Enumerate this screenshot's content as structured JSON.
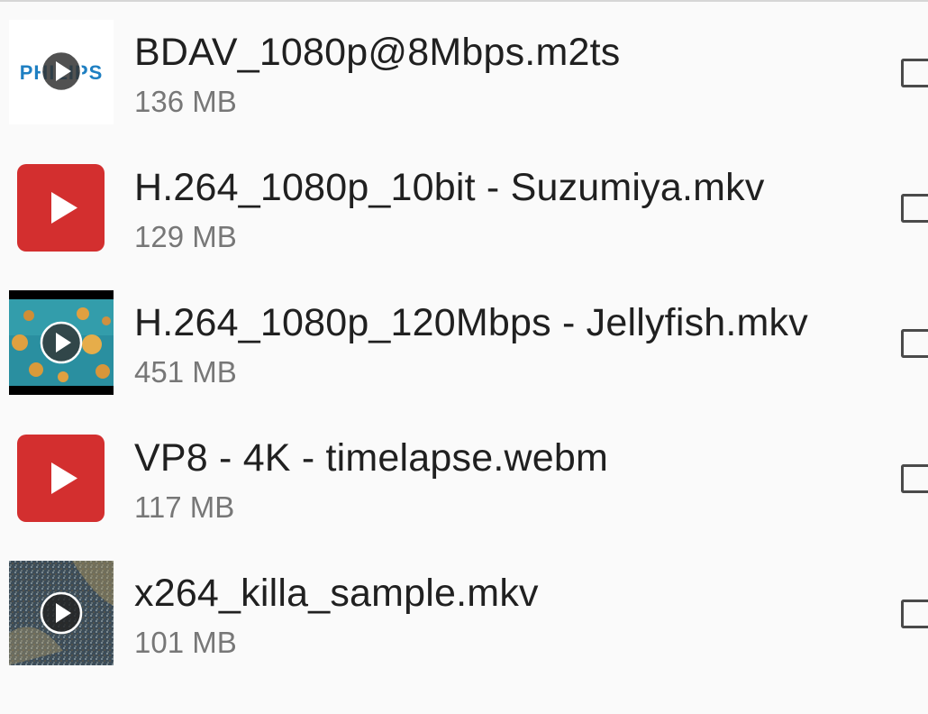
{
  "files": [
    {
      "name": "BDAV_1080p@8Mbps.m2ts",
      "size": "136 MB",
      "thumbnail": "philips-logo-thumbnail",
      "thumb_text": "PHILIPS",
      "checked": false
    },
    {
      "name": "H.264_1080p_10bit - Suzumiya.mkv",
      "size": "129 MB",
      "thumbnail": "play-icon",
      "checked": false
    },
    {
      "name": "H.264_1080p_120Mbps - Jellyfish.mkv",
      "size": "451 MB",
      "thumbnail": "jellyfish-thumbnail",
      "checked": false
    },
    {
      "name": "VP8 - 4K - timelapse.webm",
      "size": "117 MB",
      "thumbnail": "play-icon",
      "checked": false
    },
    {
      "name": "x264_killa_sample.mkv",
      "size": "101 MB",
      "thumbnail": "killa-sample-thumbnail",
      "checked": false
    }
  ],
  "colors": {
    "background": "#fafafa",
    "play_red": "#d32f2f",
    "philips_blue": "#1e7fc2",
    "jellyfish_water": "#2a8fa0",
    "jellyfish_orange": "#e0a040",
    "name_text": "#202020",
    "size_text": "#777777"
  }
}
